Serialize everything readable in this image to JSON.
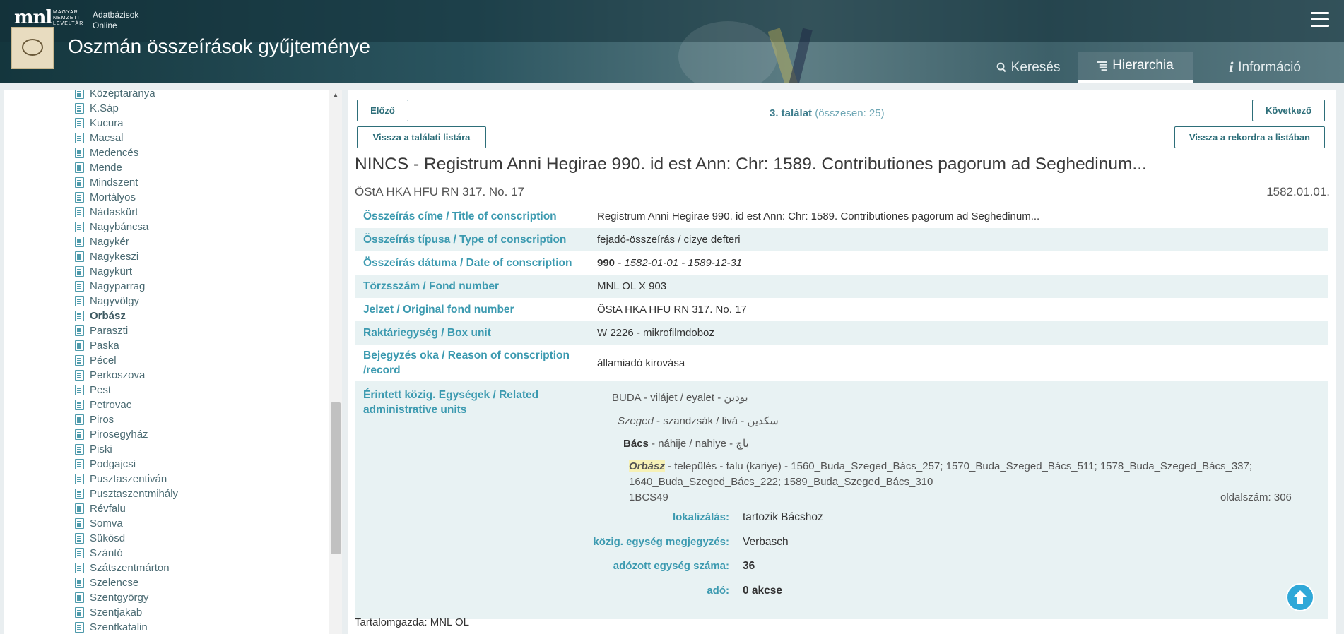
{
  "header": {
    "logo_text": "mnl",
    "logo_sub_1": "MAGYAR",
    "logo_sub_2": "NEMZETI",
    "logo_sub_3": "LEVÉLTÁR",
    "brand_line1": "Adatbázisok",
    "brand_line2": "Online",
    "site_title": "Oszmán összeírások gyűjteménye",
    "nav": [
      {
        "label": "Keresés",
        "icon": "search-icon"
      },
      {
        "label": "Hierarchia",
        "icon": "hierarchy-icon"
      },
      {
        "label": "Információ",
        "icon": "info-icon"
      }
    ],
    "active_nav": "Hierarchia"
  },
  "sidebar": {
    "items": [
      "Középtaránya",
      "K.Sáp",
      "Kucura",
      "Macsal",
      "Medencés",
      "Mende",
      "Mindszent",
      "Mortályos",
      "Nádaskürt",
      "Nagybáncsa",
      "Nagykér",
      "Nagykeszi",
      "Nagykürt",
      "Nagyparrag",
      "Nagyvölgy",
      "Orbász",
      "Paraszti",
      "Paska",
      "Pécel",
      "Perkoszova",
      "Pest",
      "Petrovac",
      "Piros",
      "Pirosegyház",
      "Piski",
      "Podgajcsi",
      "Pusztaszentiván",
      "Pusztaszentmihály",
      "Révfalu",
      "Somva",
      "Sükösd",
      "Szántó",
      "Szátszentmárton",
      "Szelencse",
      "Szentgyörgy",
      "Szentjakab",
      "Szentkatalin"
    ],
    "selected": "Orbász"
  },
  "toolbar": {
    "prev_label": "Előző",
    "back_to_list_label": "Vissza a találati listára",
    "next_label": "Következő",
    "back_to_record_label": "Vissza a rekordra a listában",
    "hit_number": "3. találat",
    "hit_total": "(összesen: 25)"
  },
  "record": {
    "title": "NINCS - Registrum Anni Hegirae 990. id est Ann: Chr: 1589. Contributiones pagorum ad Seghedinum...",
    "signature": "ÖStA HKA HFU RN 317. No. 17",
    "date": "1582.01.01.",
    "fields": [
      {
        "label": "Összeírás címe / Title of conscription",
        "value": "Registrum Anni Hegirae 990. id est Ann: Chr: 1589. Contributiones pagorum ad Seghedinum..."
      },
      {
        "label": "Összeírás típusa / Type of conscription",
        "value": "fejadó-összeírás / cizye defteri"
      },
      {
        "label": "Összeírás dátuma / Date of conscription",
        "value_bold": "990",
        "value": " - 1582-01-01 - 1589-12-31"
      },
      {
        "label": "Törzsszám / Fond number",
        "value": "MNL OL X 903"
      },
      {
        "label": "Jelzet / Original fond number",
        "value": "ÖStA HKA HFU RN 317. No. 17"
      },
      {
        "label": "Raktáriegység / Box unit",
        "value": "W 2226 - mikrofilmdoboz"
      },
      {
        "label_line1": "Bejegyzés oka / Reason of conscription",
        "label_line2": "/record",
        "value": "államiadó kirovása"
      },
      {
        "label_line1": "Érintett közig. Egységek / Related",
        "label_line2": "administrative units"
      }
    ],
    "units": {
      "l1_name": "BUDA",
      "l1_rest": " - vilájet / eyalet - بودين",
      "l2_name": "Szeged",
      "l2_rest": " - szandzsák / livá - سكدين",
      "l3_name": "Bács",
      "l3_rest": " - náhije / nahiye - باچ",
      "l4_name": "Orbász",
      "l4_rest": " - település - falu (kariye) - 1560_Buda_Szeged_Bács_257; 1570_Buda_Szeged_Bács_511; 1578_Buda_Szeged_Bács_337;",
      "l4_cont": "1640_Buda_Szeged_Bács_222; 1589_Buda_Szeged_Bács_310",
      "code": "1BCS49",
      "page": "oldalszám: 306",
      "details": [
        {
          "label": "lokalizálás:",
          "value": "tartozik Bácshoz",
          "bold": false
        },
        {
          "label": "közig. egység megjegyzés:",
          "value": "Verbasch",
          "bold": false
        },
        {
          "label": "adózott egység száma:",
          "value": "36",
          "bold": true
        },
        {
          "label": "adó:",
          "value": "0 akcse",
          "bold": true
        }
      ]
    },
    "footer": "Tartalomgazda: MNL OL"
  },
  "colors": {
    "accent": "#3c9ab0",
    "button": "#2d6e79",
    "row_shade": "#e8f2f3",
    "highlight": "#f6f1b6",
    "scroll_top_button": "#2fa8d8"
  }
}
